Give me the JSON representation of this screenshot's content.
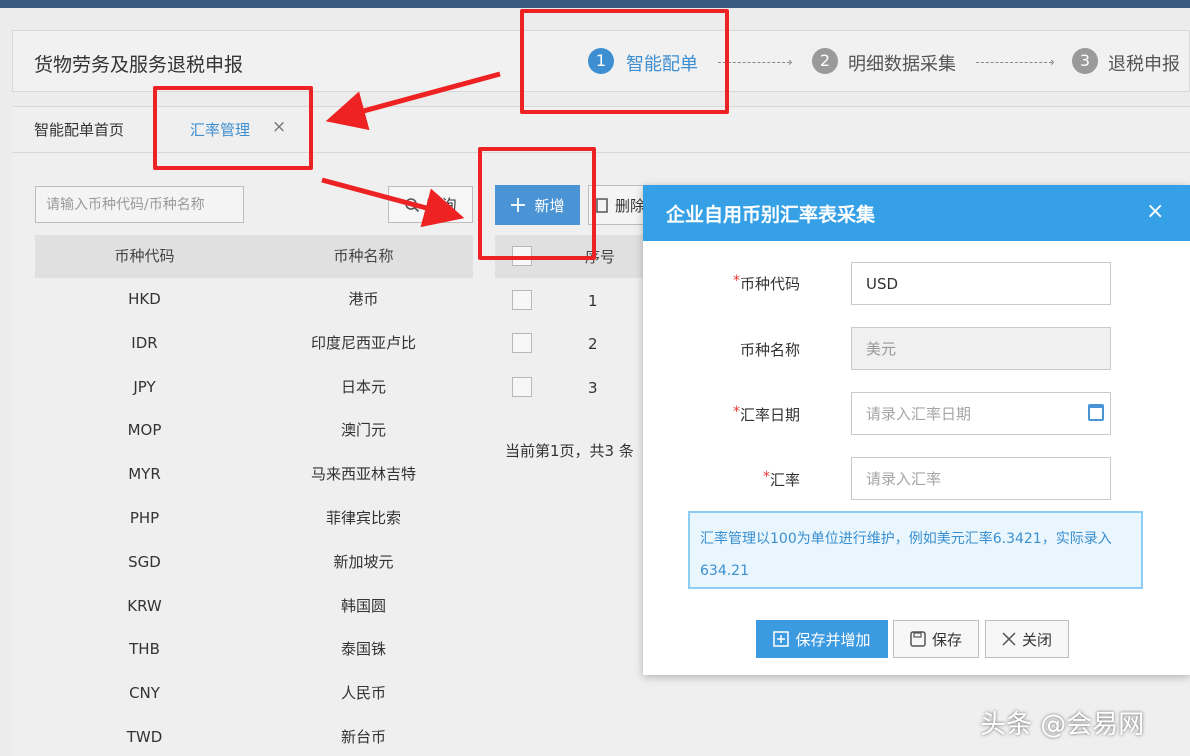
{
  "header": {
    "title": "货物劳务及服务退税申报",
    "steps": [
      {
        "num": "1",
        "label": "智能配单",
        "active": true
      },
      {
        "num": "2",
        "label": "明细数据采集",
        "active": false
      },
      {
        "num": "3",
        "label": "退税申报",
        "active": false
      }
    ]
  },
  "tabs": [
    {
      "label": "智能配单首页"
    },
    {
      "label": "汇率管理",
      "close": "×"
    }
  ],
  "search": {
    "placeholder": "请输入币种代码/币种名称",
    "query_label": "查询"
  },
  "left_table": {
    "columns": [
      "币种代码",
      "币种名称"
    ],
    "rows": [
      [
        "HKD",
        "港币"
      ],
      [
        "IDR",
        "印度尼西亚卢比"
      ],
      [
        "JPY",
        "日本元"
      ],
      [
        "MOP",
        "澳门元"
      ],
      [
        "MYR",
        "马来西亚林吉特"
      ],
      [
        "PHP",
        "菲律宾比索"
      ],
      [
        "SGD",
        "新加坡元"
      ],
      [
        "KRW",
        "韩国圆"
      ],
      [
        "THB",
        "泰国铢"
      ],
      [
        "CNY",
        "人民币"
      ],
      [
        "TWD",
        "新台币"
      ]
    ]
  },
  "toolbar": {
    "add_label": "新增",
    "delete_label": "删除"
  },
  "mid_table": {
    "header": "序号",
    "rows": [
      "1",
      "2",
      "3"
    ],
    "pager": "当前第1页，共3 条"
  },
  "modal": {
    "title": "企业自用币别汇率表采集",
    "close": "×",
    "fields": {
      "code": {
        "label": "币种代码",
        "value": "USD",
        "required_mark": "*"
      },
      "name": {
        "label": "币种名称",
        "value": "美元"
      },
      "date": {
        "label": "汇率日期",
        "placeholder": "请录入汇率日期",
        "required_mark": "*"
      },
      "rate": {
        "label": "汇率",
        "placeholder": "请录入汇率",
        "required_mark": "*"
      }
    },
    "note": "汇率管理以100为单位进行维护，例如美元汇率6.3421，实际录入634.21",
    "buttons": {
      "save_add": "保存并增加",
      "save": "保存",
      "close": "关闭"
    }
  },
  "watermark": "头条 @会易网",
  "colors": {
    "accent": "#36a0e6",
    "highlight": "#ee2222",
    "header_bar": "#3a5a80"
  },
  "icons": [
    "plus-icon",
    "search-icon",
    "calendar-icon",
    "save-icon",
    "close-icon",
    "arrow-annotation"
  ]
}
